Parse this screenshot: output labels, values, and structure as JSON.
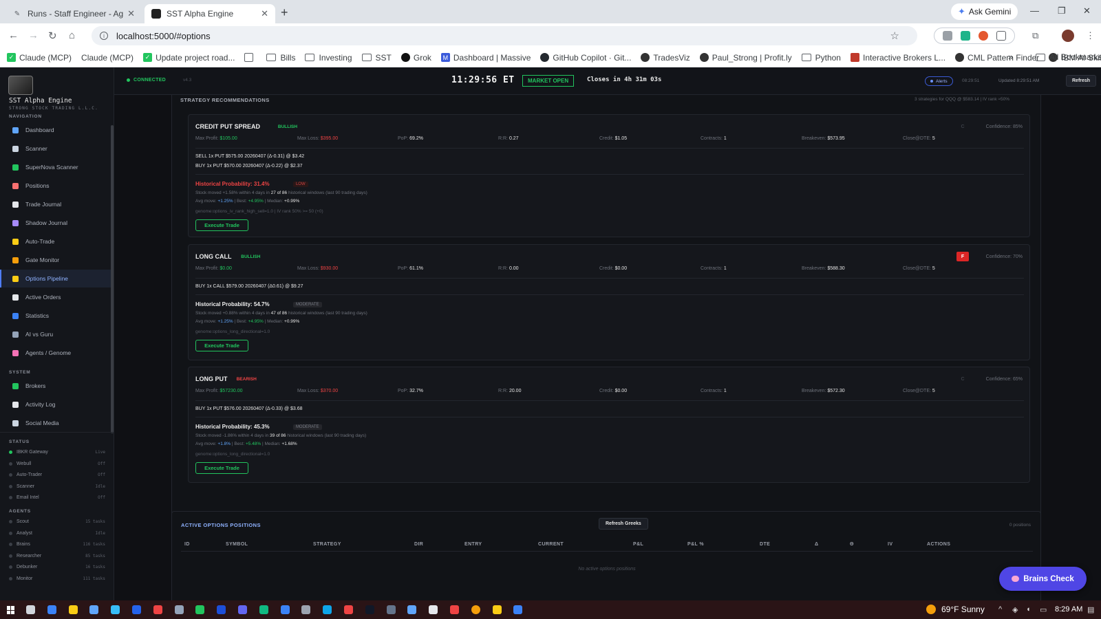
{
  "browser": {
    "tabs": [
      {
        "title": "Runs - Staff Engineer - Agents - I",
        "active": false
      },
      {
        "title": "SST Alpha Engine",
        "active": true
      }
    ],
    "new_tab": "+",
    "ask_gemini": "Ask Gemini",
    "url": "localhost:5000/#options",
    "bookmarks": [
      {
        "label": "Claude (MCP)",
        "icon": "green-check-icon"
      },
      {
        "label": "Claude (MCP)",
        "icon": ""
      },
      {
        "label": "Update project road...",
        "icon": "green-check-icon"
      },
      {
        "label": "",
        "icon": "apps-grid-icon"
      },
      {
        "label": "Bills",
        "icon": "folder-icon"
      },
      {
        "label": "Investing",
        "icon": "folder-icon"
      },
      {
        "label": "SST",
        "icon": "folder-icon"
      },
      {
        "label": "Grok",
        "icon": "grok-icon"
      },
      {
        "label": "Dashboard | Massive",
        "icon": "massive-icon"
      },
      {
        "label": "GitHub Copilot · Git...",
        "icon": "github-icon"
      },
      {
        "label": "TradesViz",
        "icon": "tradesviz-icon"
      },
      {
        "label": "Paul_Strong | Profit.ly",
        "icon": "profitly-icon"
      },
      {
        "label": "Python",
        "icon": "folder-icon"
      },
      {
        "label": "Interactive Brokers L...",
        "icon": "ibkr-icon"
      },
      {
        "label": "CML Pattern Finder",
        "icon": "cml-icon"
      },
      {
        "label": "IBM AI SkillsBuild",
        "icon": "ibm-icon"
      }
    ],
    "bookmarks_more": "»",
    "all_bookmarks": "All Bookmarks"
  },
  "brand": {
    "name": "SST Alpha Engine",
    "sub": "STRONG STOCK TRADING L.L.C."
  },
  "sidebar": {
    "nav_title": "NAVIGATION",
    "nav": [
      {
        "label": "Dashboard",
        "color": "#60a5fa"
      },
      {
        "label": "Scanner",
        "color": "#cbd5e1"
      },
      {
        "label": "SuperNova Scanner",
        "color": "#22c55e"
      },
      {
        "label": "Positions",
        "color": "#f87171"
      },
      {
        "label": "Trade Journal",
        "color": "#e5e7eb"
      },
      {
        "label": "Shadow Journal",
        "color": "#a78bfa"
      },
      {
        "label": "Auto-Trade",
        "color": "#facc15"
      },
      {
        "label": "Gate Monitor",
        "color": "#f59e0b"
      },
      {
        "label": "Options Pipeline",
        "color": "#facc15",
        "active": true
      },
      {
        "label": "Active Orders",
        "color": "#e5e7eb"
      },
      {
        "label": "Statistics",
        "color": "#3b82f6"
      },
      {
        "label": "AI vs Guru",
        "color": "#94a3b8"
      },
      {
        "label": "Agents / Genome",
        "color": "#f472b6"
      }
    ],
    "system_title": "SYSTEM",
    "system": [
      {
        "label": "Brokers",
        "color": "#22c55e"
      },
      {
        "label": "Activity Log",
        "color": "#e5e7eb"
      },
      {
        "label": "Social Media",
        "color": "#cbd5e1"
      }
    ],
    "status_title": "STATUS",
    "status": [
      {
        "label": "IBKR Gateway",
        "value": "Live",
        "on": true
      },
      {
        "label": "Webull",
        "value": "Off",
        "on": false
      },
      {
        "label": "Auto-Trader",
        "value": "Off",
        "on": false
      },
      {
        "label": "Scanner",
        "value": "Idle",
        "on": false
      },
      {
        "label": "Email Intel",
        "value": "Off",
        "on": false
      }
    ],
    "agents_title": "AGENTS",
    "agents": [
      {
        "label": "Scout",
        "value": "15 tasks"
      },
      {
        "label": "Analyst",
        "value": "Idle"
      },
      {
        "label": "Brains",
        "value": "116 tasks"
      },
      {
        "label": "Researcher",
        "value": "85 tasks"
      },
      {
        "label": "Debunker",
        "value": "16 tasks"
      },
      {
        "label": "Monitor",
        "value": "111 tasks"
      }
    ]
  },
  "topbar": {
    "connected": "CONNECTED",
    "version": "v4.3",
    "clock": "11:29:56 ET",
    "market": "MARKET OPEN",
    "closes": "Closes in 4h 31m 03s",
    "alerts": "Alerts",
    "alert_time": "08:29:51",
    "updated": "Updated 8:29:51 AM",
    "refresh": "Refresh"
  },
  "recommendations": {
    "title": "STRATEGY RECOMMENDATIONS",
    "subtitle": "3 strategies for QQQ @ $583.14 | IV rank ≈50%",
    "labels": {
      "max_profit": "Max Profit:",
      "max_loss": "Max Loss:",
      "pop": "PoP:",
      "rr": "R:R:",
      "credit": "Credit:",
      "contracts": "Contracts:",
      "breakeven": "Breakeven:",
      "close_dte": "Close@DTE:"
    },
    "cards": [
      {
        "name": "CREDIT PUT SPREAD",
        "direction": "BULLISH",
        "dir_class": "bull",
        "confidence": "Confidence: 85%",
        "grade": "C",
        "grade_style": "dim",
        "max_profit": "$105.00",
        "max_loss": "$395.00",
        "pop": "69.2%",
        "rr": "0.27",
        "credit": "$1.05",
        "contracts": "1",
        "breakeven": "$573.95",
        "close_dte": "5",
        "legs": [
          "SELL 1x PUT $575.00 20260407 (Δ-0.31) @ $3.42",
          "BUY 1x PUT $570.00 20260407 (Δ-0.22) @ $2.37"
        ],
        "hp_title": "Historical Probability: 31.4%",
        "hp_color": "#ef4444",
        "hp_badge": "LOW",
        "hp_badge_style": "low",
        "hp_line1_a": "Stock moved +1.58% within 4 days in ",
        "hp_line1_b": "27 of 86",
        "hp_line1_c": " historical windows (last 90 trading days)",
        "avg": "+1.25%",
        "best": "+4.95%",
        "median": "+0.99%",
        "genome": "genome:options_iv_rank_high_sell=1.0 | IV rank 50% >= 50 (+0)",
        "execute": "Execute Trade"
      },
      {
        "name": "LONG CALL",
        "direction": "BULLISH",
        "dir_class": "bull",
        "confidence": "Confidence: 70%",
        "grade": "F",
        "grade_style": "red",
        "max_profit": "$0.00",
        "max_loss": "$930.00",
        "pop": "61.1%",
        "rr": "0.00",
        "credit": "$0.00",
        "contracts": "1",
        "breakeven": "$588.30",
        "close_dte": "5",
        "legs": [
          "BUY 1x CALL $579.00 20260407 (Δ0.61) @ $9.27"
        ],
        "hp_title": "Historical Probability: 54.7%",
        "hp_color": "#f0f0f0",
        "hp_badge": "MODERATE",
        "hp_badge_style": "mod",
        "hp_line1_a": "Stock moved +0.88% within 4 days in ",
        "hp_line1_b": "47 of 86",
        "hp_line1_c": " historical windows (last 90 trading days)",
        "avg": "+1.25%",
        "best": "+4.95%",
        "median": "+0.99%",
        "genome": "genome:options_long_directional=1.0",
        "execute": "Execute Trade"
      },
      {
        "name": "LONG PUT",
        "direction": "BEARISH",
        "dir_class": "bear",
        "confidence": "Confidence: 65%",
        "grade": "C",
        "grade_style": "dim",
        "max_profit": "$57230.00",
        "max_loss": "$370.00",
        "pop": "32.7%",
        "rr": "20.00",
        "credit": "$0.00",
        "contracts": "1",
        "breakeven": "$572.30",
        "close_dte": "5",
        "legs": [
          "BUY 1x PUT $576.00 20260407 (Δ-0.33) @ $3.68"
        ],
        "hp_title": "Historical Probability: 45.3%",
        "hp_color": "#f0f0f0",
        "hp_badge": "MODERATE",
        "hp_badge_style": "mod",
        "hp_line1_a": "Stock moved -1.86% within 4 days in ",
        "hp_line1_b": "39 of 86",
        "hp_line1_c": " historical windows (last 90 trading days)",
        "avg": "+1.8%",
        "best": "+5.48%",
        "median": "+1.68%",
        "genome": "genome:options_long_directional=1.0",
        "execute": "Execute Trade"
      }
    ]
  },
  "positions": {
    "title": "ACTIVE OPTIONS POSITIONS",
    "refresh_greeks": "Refresh Greeks",
    "count": "0 positions",
    "columns": [
      "ID",
      "SYMBOL",
      "STRATEGY",
      "DIR",
      "ENTRY",
      "CURRENT",
      "P&L",
      "P&L %",
      "DTE",
      "Δ",
      "Θ",
      "IV",
      "ACTIONS"
    ],
    "empty": "No active options positions"
  },
  "brains_check": "Brains Check",
  "taskbar": {
    "weather": "69°F  Sunny",
    "time": "8:29 AM"
  }
}
